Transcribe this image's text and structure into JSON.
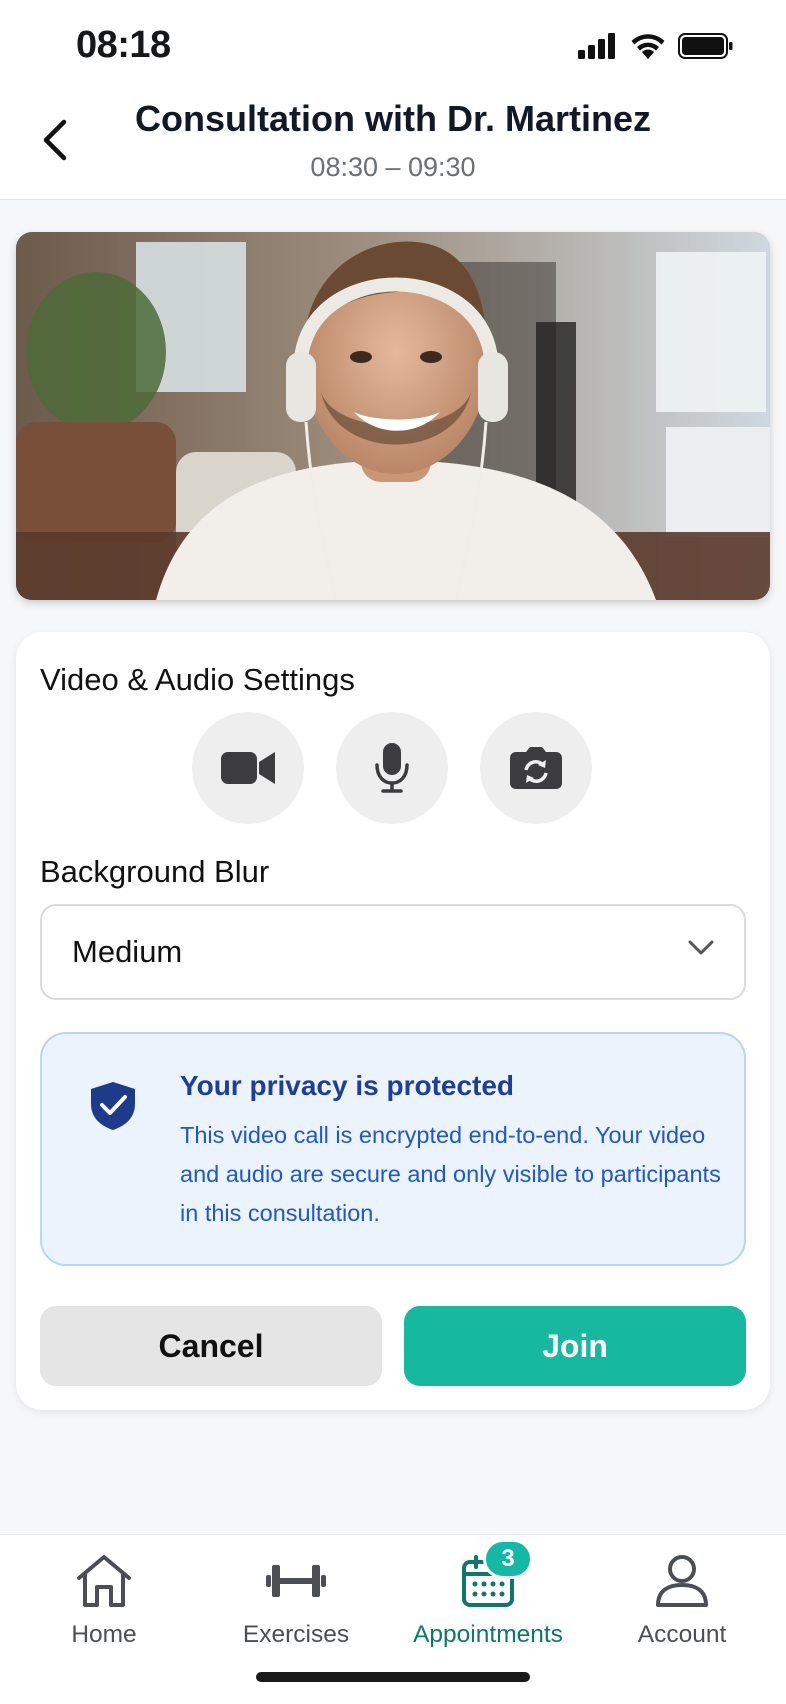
{
  "status_bar": {
    "time": "08:18"
  },
  "header": {
    "title": "Consultation with Dr. Martinez",
    "time_range": "08:30 – 09:30"
  },
  "video_preview": {
    "icon": "camera-preview-image"
  },
  "settings": {
    "title": "Video & Audio Settings",
    "controls": [
      {
        "name": "camera-toggle",
        "icon": "video-camera-icon"
      },
      {
        "name": "microphone-toggle",
        "icon": "microphone-icon"
      },
      {
        "name": "switch-camera",
        "icon": "camera-rotate-icon"
      }
    ],
    "background_blur": {
      "label": "Background Blur",
      "selected": "Medium"
    },
    "privacy": {
      "title": "Your privacy is protected",
      "text": "This video call is encrypted end-to-end. Your video and audio are secure and only visible to participants in this consultation."
    },
    "cancel_label": "Cancel",
    "join_label": "Join"
  },
  "nav": {
    "items": [
      {
        "label": "Home",
        "icon": "home-icon"
      },
      {
        "label": "Exercises",
        "icon": "dumbbell-icon"
      },
      {
        "label": "Appointments",
        "icon": "calendar-icon",
        "badge": "3",
        "active": true
      },
      {
        "label": "Account",
        "icon": "user-icon"
      }
    ]
  },
  "colors": {
    "accent": "#17b8a0",
    "privacy_bg": "#ebf3fd",
    "privacy_title": "#1f3f94",
    "privacy_text": "#2157c7",
    "active_nav": "#0f766e"
  }
}
